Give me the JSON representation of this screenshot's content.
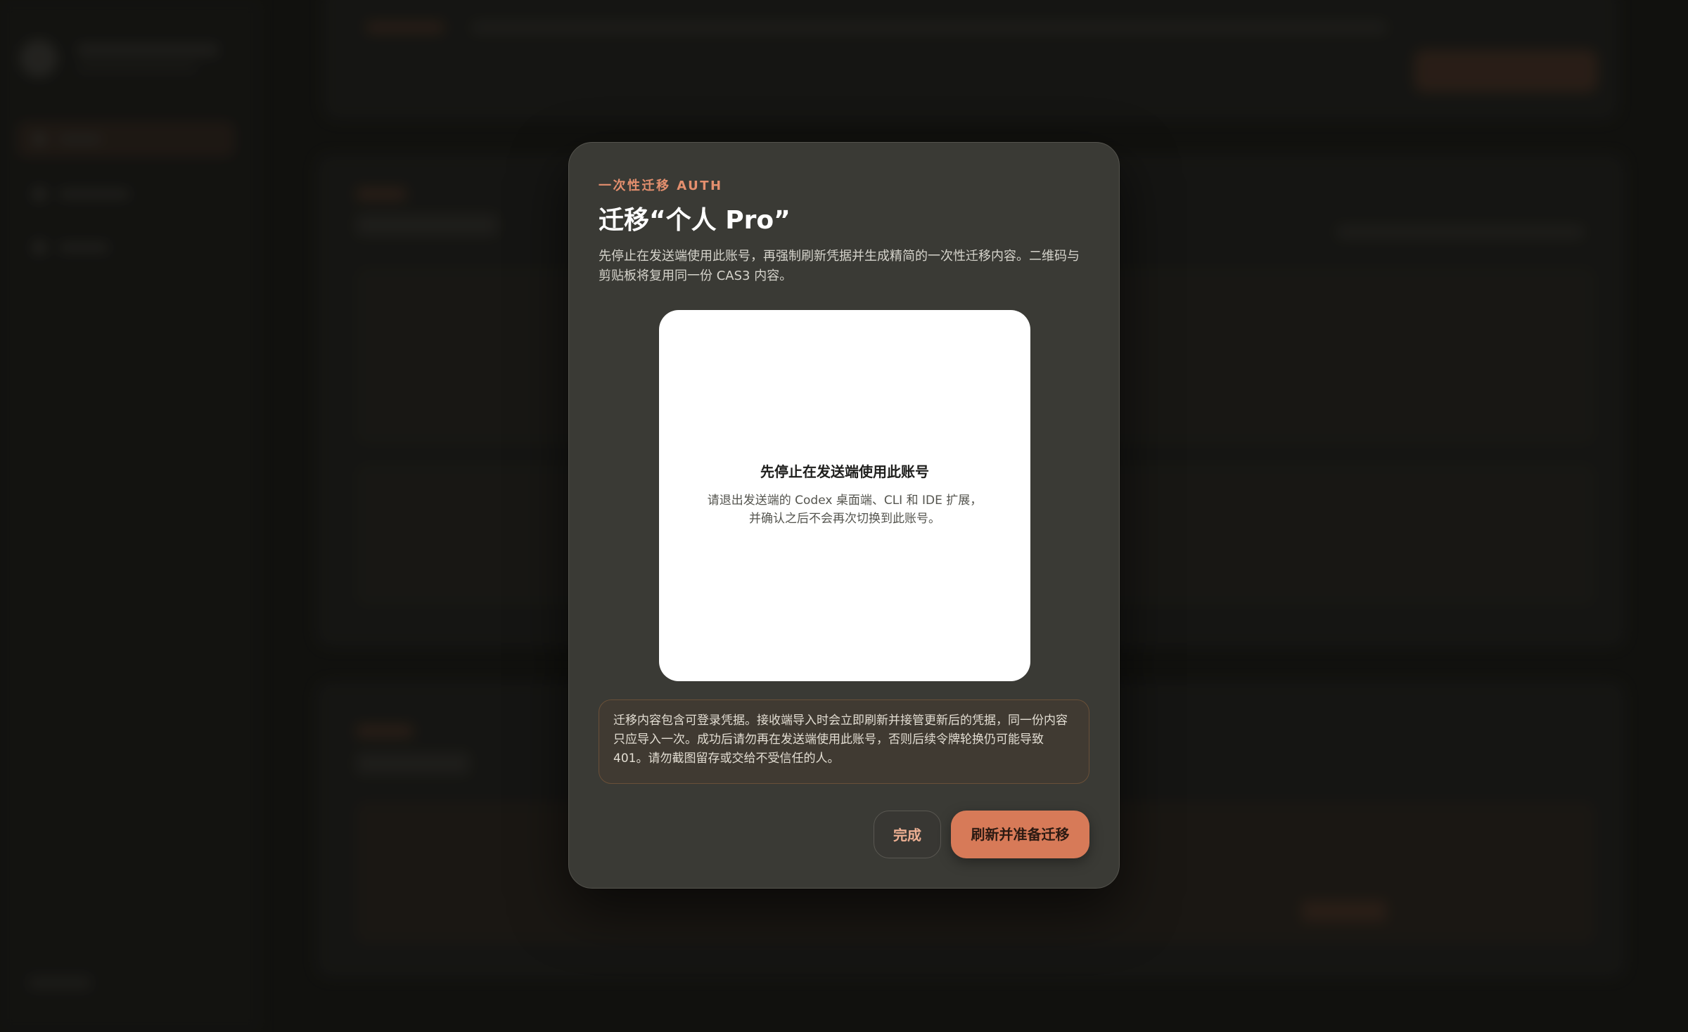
{
  "modal": {
    "eyebrow": "一次性迁移 AUTH",
    "title": "迁移“个人 Pro”",
    "description": "先停止在发送端使用此账号，再强制刷新凭据并生成精简的一次性迁移内容。二维码与剪贴板将复用同一份 CAS3 内容。",
    "qr_panel": {
      "title": "先停止在发送端使用此账号",
      "line1": "请退出发送端的 Codex 桌面端、CLI 和 IDE 扩展，",
      "line2": "并确认之后不会再次切换到此账号。"
    },
    "warning": "迁移内容包含可登录凭据。接收端导入时会立即刷新并接管更新后的凭据，同一份内容只应导入一次。成功后请勿再在发送端使用此账号，否则后续令牌轮换仍可能导致 401。请勿截图留存或交给不受信任的人。",
    "buttons": {
      "done": "完成",
      "refresh": "刷新并准备迁移"
    }
  },
  "colors": {
    "accent": "#d77a58",
    "eyebrow": "#e48f6e",
    "modal_bg": "#3a3a35"
  }
}
